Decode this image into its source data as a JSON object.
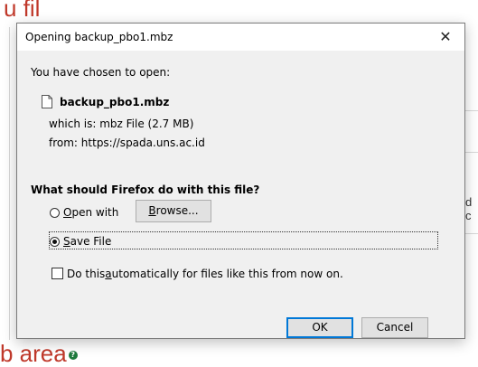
{
  "background": {
    "heading_top": "u fil",
    "heading_bottom": "b area",
    "help_icon_glyph": "?",
    "right_text": "d c"
  },
  "dialog": {
    "title": "Opening backup_pbo1.mbz",
    "close_glyph": "✕",
    "chosen_label": "You have chosen to open:",
    "file_name": "backup_pbo1.mbz",
    "which_is_label": "which is:",
    "which_is_value": "mbz File (2.7 MB)",
    "from_label": "from:",
    "from_value": "https://spada.uns.ac.id",
    "question": "What should Firefox do with this file?",
    "open_with": {
      "accel": "O",
      "rest": "pen with",
      "selected": false
    },
    "browse": {
      "accel": "B",
      "rest": "rowse..."
    },
    "save_file": {
      "accel": "S",
      "rest": "ave File",
      "selected": true
    },
    "auto_checkbox": {
      "before": "Do this ",
      "accel": "a",
      "after": "utomatically for files like this from now on.",
      "checked": false
    },
    "ok_label": "OK",
    "cancel_label": "Cancel"
  },
  "colors": {
    "accent": "#0078d7",
    "background_heading": "#c0392b",
    "help_icon": "#1e7a3d"
  }
}
